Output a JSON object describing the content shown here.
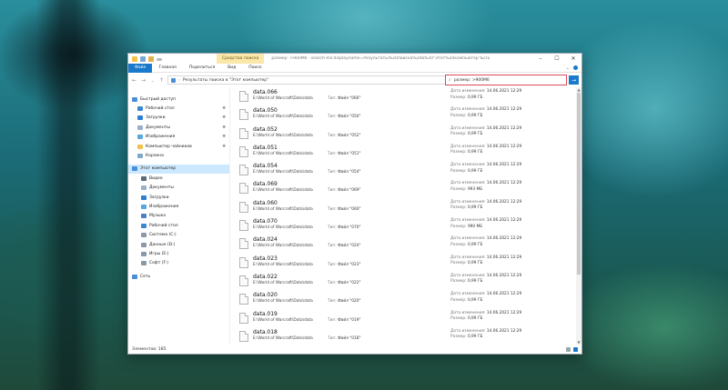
{
  "window": {
    "context_tab": "Средства поиска",
    "title": "размер: >900Мб - search-ms:displayname=Результаты%20поиска%20в%20\"Этот%20компьютер\"&crumb=local"
  },
  "ribbon": {
    "tabs": [
      "Файл",
      "Главная",
      "Поделиться",
      "Вид",
      "Поиск"
    ]
  },
  "address": {
    "path": "Результаты поиска в \"Этот компьютер\""
  },
  "search": {
    "value": "размер: >900Мб"
  },
  "nav": {
    "quick_access": "Быстрый доступ",
    "quick_items": [
      "Рабочий стол",
      "Загрузки",
      "Документы",
      "Изображения",
      "Компьютер чайников",
      "Корзина"
    ],
    "this_pc": "Этот компьютер",
    "pc_items": [
      "Видео",
      "Документы",
      "Загрузки",
      "Изображения",
      "Музыка",
      "Рабочий стол",
      "Система (C:)",
      "Данные (D:)",
      "Игры (E:)",
      "Софт (F:)"
    ],
    "network": "Сеть"
  },
  "files": [
    {
      "name": "data.066",
      "path": "E:\\World of Warcraft\\Data\\data",
      "type_label": "Тип:",
      "type": "Файл \"066\"",
      "date_label": "Дата изменения:",
      "date": "14.06.2021 12:29",
      "size_label": "Размер:",
      "size": "0,99 ГБ"
    },
    {
      "name": "data.050",
      "path": "E:\\World of Warcraft\\Data\\data",
      "type_label": "Тип:",
      "type": "Файл \"050\"",
      "date_label": "Дата изменения:",
      "date": "14.06.2021 12:29",
      "size_label": "Размер:",
      "size": "0,99 ГБ"
    },
    {
      "name": "data.052",
      "path": "E:\\World of Warcraft\\Data\\data",
      "type_label": "Тип:",
      "type": "Файл \"052\"",
      "date_label": "Дата изменения:",
      "date": "14.06.2021 12:29",
      "size_label": "Размер:",
      "size": "0,99 ГБ"
    },
    {
      "name": "data.051",
      "path": "E:\\World of Warcraft\\Data\\data",
      "type_label": "Тип:",
      "type": "Файл \"051\"",
      "date_label": "Дата изменения:",
      "date": "14.06.2021 12:29",
      "size_label": "Размер:",
      "size": "0,99 ГБ"
    },
    {
      "name": "data.054",
      "path": "E:\\World of Warcraft\\Data\\data",
      "type_label": "Тип:",
      "type": "Файл \"054\"",
      "date_label": "Дата изменения:",
      "date": "14.06.2021 12:29",
      "size_label": "Размер:",
      "size": "0,99 ГБ"
    },
    {
      "name": "data.069",
      "path": "E:\\World of Warcraft\\Data\\data",
      "type_label": "Тип:",
      "type": "Файл \"069\"",
      "date_label": "Дата изменения:",
      "date": "14.06.2021 12:29",
      "size_label": "Размер:",
      "size": "993 МБ"
    },
    {
      "name": "data.060",
      "path": "E:\\World of Warcraft\\Data\\data",
      "type_label": "Тип:",
      "type": "Файл \"060\"",
      "date_label": "Дата изменения:",
      "date": "14.06.2021 12:29",
      "size_label": "Размер:",
      "size": "0,99 ГБ"
    },
    {
      "name": "data.070",
      "path": "E:\\World of Warcraft\\Data\\data",
      "type_label": "Тип:",
      "type": "Файл \"070\"",
      "date_label": "Дата изменения:",
      "date": "14.06.2021 12:29",
      "size_label": "Размер:",
      "size": "990 МБ"
    },
    {
      "name": "data.024",
      "path": "E:\\World of Warcraft\\Data\\data",
      "type_label": "Тип:",
      "type": "Файл \"024\"",
      "date_label": "Дата изменения:",
      "date": "14.06.2021 12:29",
      "size_label": "Размер:",
      "size": "0,99 ГБ"
    },
    {
      "name": "data.023",
      "path": "E:\\World of Warcraft\\Data\\data",
      "type_label": "Тип:",
      "type": "Файл \"023\"",
      "date_label": "Дата изменения:",
      "date": "14.06.2021 12:29",
      "size_label": "Размер:",
      "size": "0,99 ГБ"
    },
    {
      "name": "data.022",
      "path": "E:\\World of Warcraft\\Data\\data",
      "type_label": "Тип:",
      "type": "Файл \"022\"",
      "date_label": "Дата изменения:",
      "date": "14.06.2021 12:29",
      "size_label": "Размер:",
      "size": "0,99 ГБ"
    },
    {
      "name": "data.020",
      "path": "E:\\World of Warcraft\\Data\\data",
      "type_label": "Тип:",
      "type": "Файл \"020\"",
      "date_label": "Дата изменения:",
      "date": "14.06.2021 12:29",
      "size_label": "Размер:",
      "size": "0,99 ГБ"
    },
    {
      "name": "data.019",
      "path": "E:\\World of Warcraft\\Data\\data",
      "type_label": "Тип:",
      "type": "Файл \"019\"",
      "date_label": "Дата изменения:",
      "date": "14.06.2021 12:29",
      "size_label": "Размер:",
      "size": "0,99 ГБ"
    },
    {
      "name": "data.018",
      "path": "E:\\World of Warcraft\\Data\\data",
      "type_label": "Тип:",
      "type": "Файл \"018\"",
      "date_label": "Дата изменения:",
      "date": "14.06.2021 12:29",
      "size_label": "Размер:",
      "size": "0,99 ГБ"
    }
  ],
  "status": {
    "count_text": "Элементов: 185"
  },
  "colors": {
    "accent": "#1979ca",
    "search_border": "#d94a5a",
    "selected": "#cce8ff",
    "context_tab": "#fbe7a9"
  }
}
